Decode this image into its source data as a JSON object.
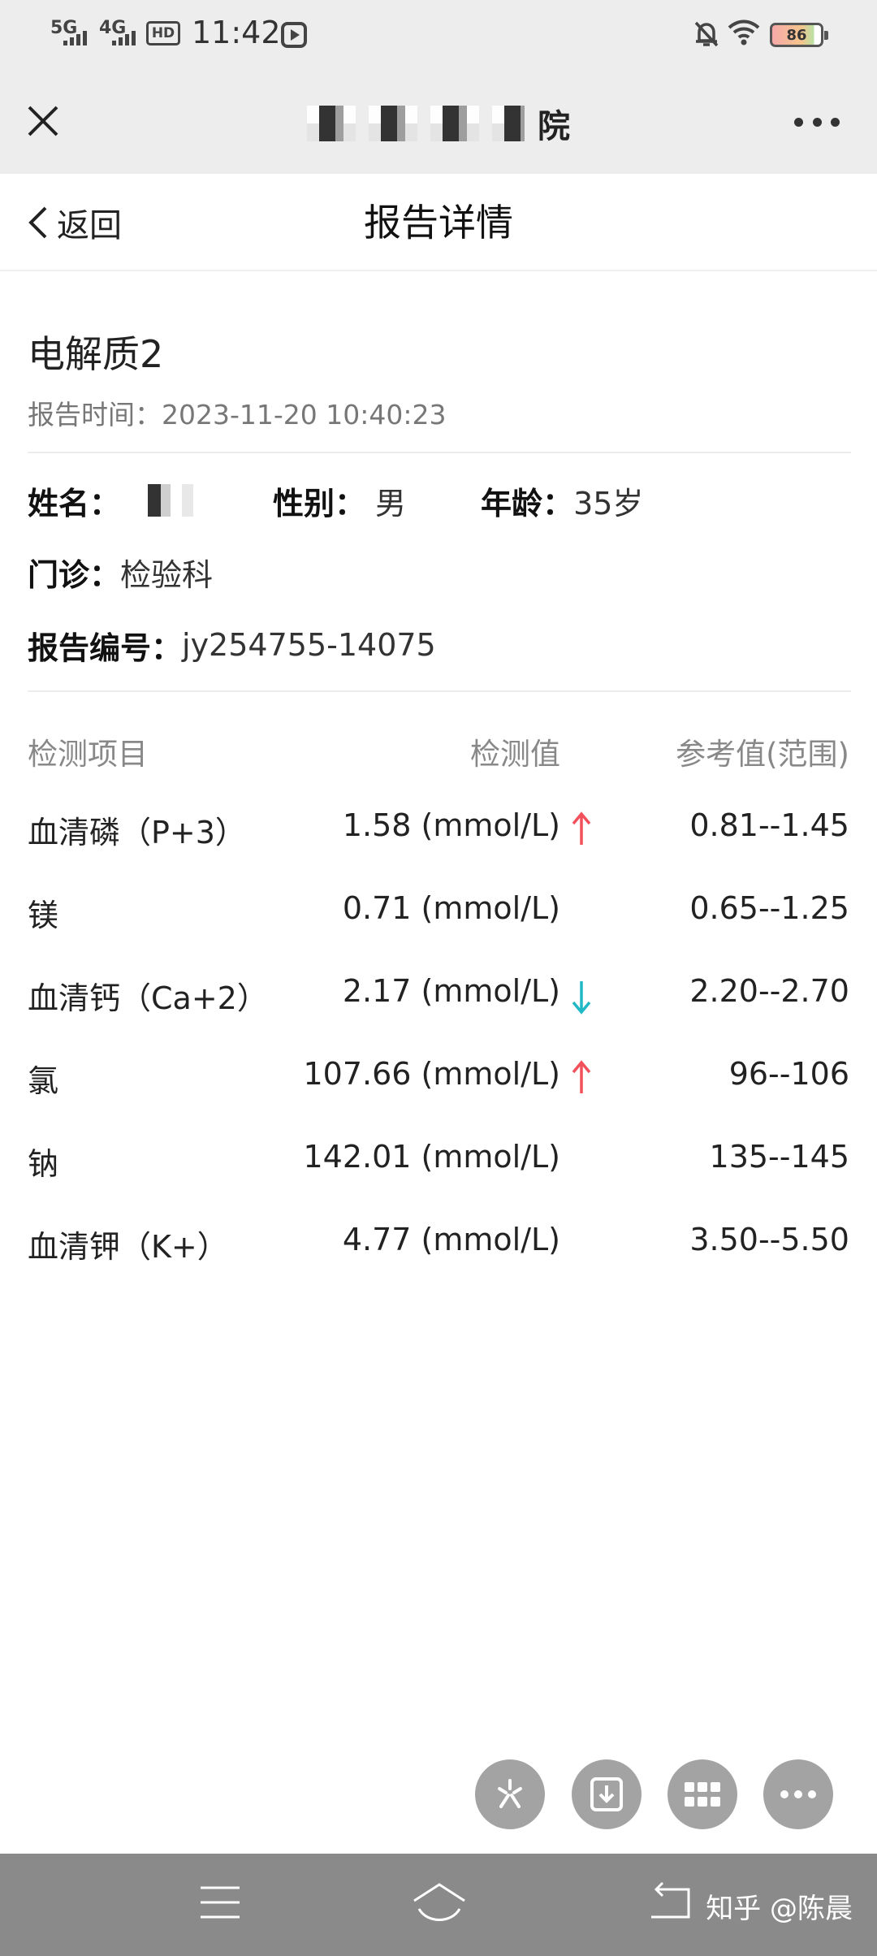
{
  "status_bar": {
    "network1": "5G",
    "network2": "4G",
    "hd": "HD",
    "time": "11:42",
    "battery": "86"
  },
  "wechat_header": {
    "hospital_name_visible": "院"
  },
  "nav": {
    "back_label": "返回",
    "page_title": "报告详情"
  },
  "report": {
    "title": "电解质2",
    "time_label": "报告时间：",
    "time_value": "2023-11-20 10:40:23"
  },
  "patient": {
    "name_label": "姓名：",
    "gender_label": "性别：",
    "gender_value": "男",
    "age_label": "年龄：",
    "age_value": "35岁",
    "clinic_label": "门诊：",
    "clinic_value": "检验科",
    "report_no_label": "报告编号：",
    "report_no_value": "jy254755-14075"
  },
  "table": {
    "headers": {
      "item": "检测项目",
      "value": "检测值",
      "reference": "参考值(范围)"
    },
    "rows": [
      {
        "name": "血清磷（P+3）",
        "value": "1.58 (mmol/L)",
        "flag": "up",
        "reference": "0.81--1.45"
      },
      {
        "name": "镁",
        "value": "0.71 (mmol/L)",
        "flag": "none",
        "reference": "0.65--1.25"
      },
      {
        "name": "血清钙（Ca+2）",
        "value": "2.17 (mmol/L)",
        "flag": "down",
        "reference": "2.20--2.70"
      },
      {
        "name": "氯",
        "value": "107.66 (mmol/L)",
        "flag": "up",
        "reference": "96--106"
      },
      {
        "name": "钠",
        "value": "142.01 (mmol/L)",
        "flag": "none",
        "reference": "135--145"
      },
      {
        "name": "血清钾（K+）",
        "value": "4.77 (mmol/L)",
        "flag": "none",
        "reference": "3.50--5.50"
      }
    ]
  },
  "colors": {
    "flag_up": "#f2505a",
    "flag_down": "#1fb8c4"
  },
  "watermark": "知乎 @陈晨"
}
